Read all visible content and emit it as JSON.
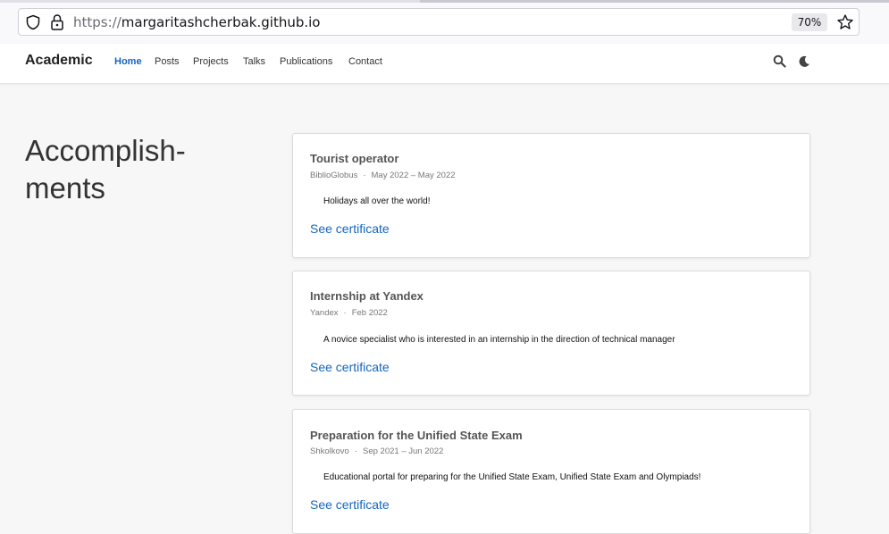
{
  "browser": {
    "url_scheme": "https://",
    "url_host": "margaritashcherbak.github.io",
    "zoom": "70%"
  },
  "navbar": {
    "brand": "Academic",
    "links": [
      {
        "label": "Home",
        "active": true
      },
      {
        "label": "Posts",
        "active": false
      },
      {
        "label": "Projects",
        "active": false
      },
      {
        "label": "Talks",
        "active": false
      },
      {
        "label": "Publications",
        "active": false
      },
      {
        "label": "Contact",
        "active": false
      }
    ],
    "icons": [
      "search-icon",
      "moon-icon"
    ]
  },
  "page": {
    "title": "Accomplish-\nments"
  },
  "accomplishments": [
    {
      "title": "Tourist operator",
      "org": "BiblioGlobus",
      "date": "May 2022 – May 2022",
      "description": "Holidays all over the world!",
      "link": "See certificate"
    },
    {
      "title": "Internship at Yandex",
      "org": "Yandex",
      "date": "Feb 2022",
      "description": "A novice specialist who is interested in an internship in the direction of technical manager",
      "link": "See certificate"
    },
    {
      "title": "Preparation for the Unified State Exam",
      "org": "Shkolkovo",
      "date": "Sep 2021 – Jun 2022",
      "description": "Educational portal for preparing for the Unified State Exam, Unified State Exam and Olympiads!",
      "link": "See certificate"
    }
  ],
  "colors": {
    "accent": "#1565c0",
    "page_bg": "#f7f7f7",
    "card_bg": "#ffffff"
  }
}
